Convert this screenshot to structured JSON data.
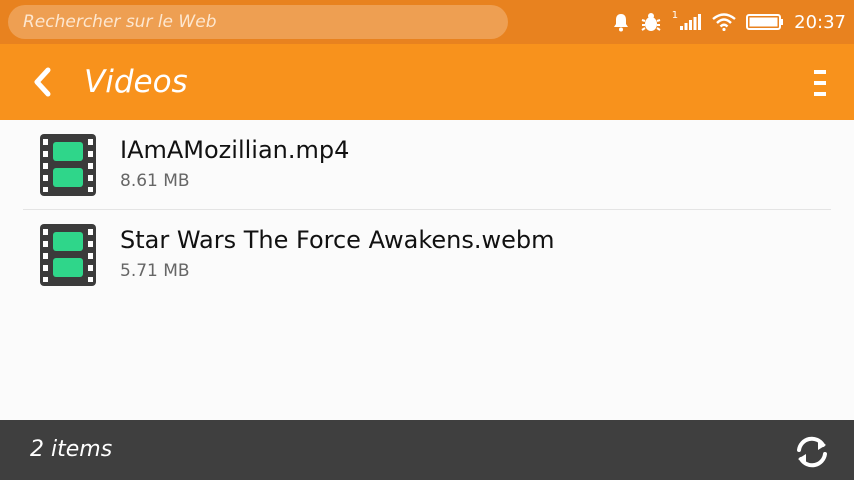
{
  "status_bar": {
    "search_placeholder": "Rechercher sur le Web",
    "sim_number": "1",
    "time": "20:37",
    "icons": [
      "bell-icon",
      "bug-icon",
      "signal-icon",
      "wifi-icon",
      "battery-icon"
    ]
  },
  "header": {
    "title": "Videos",
    "back_icon": "chevron-left-icon",
    "menu_icon": "kebab-menu-icon"
  },
  "videos": [
    {
      "name": "IAmAMozillian.mp4",
      "size": "8.61 MB",
      "icon": "film-icon"
    },
    {
      "name": "Star Wars The Force Awakens.webm",
      "size": "5.71 MB",
      "icon": "film-icon"
    }
  ],
  "footer": {
    "count": "2 items",
    "refresh_icon": "refresh-icon"
  },
  "colors": {
    "status_bar": "#e8821f",
    "header": "#f8921c",
    "footer": "#3f3f3f",
    "film_frame": "#2e9e63"
  }
}
